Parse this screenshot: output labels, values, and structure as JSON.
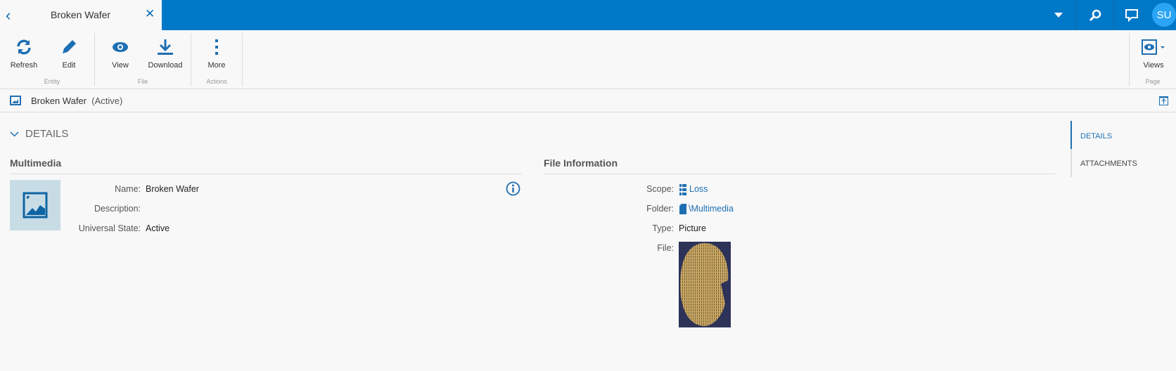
{
  "tab": {
    "title": "Broken Wafer"
  },
  "topbar": {
    "avatar": "SU",
    "icons": [
      "dropdown-caret-icon",
      "search-icon",
      "chat-icon"
    ]
  },
  "toolbar": {
    "buttons": [
      {
        "label": "Refresh"
      },
      {
        "label": "Edit"
      },
      {
        "label": "View"
      },
      {
        "label": "Download"
      },
      {
        "label": "More"
      },
      {
        "label": "Views"
      }
    ],
    "groups": [
      "Entity",
      "File",
      "Actions",
      "Page"
    ]
  },
  "header": {
    "title": "Broken Wafer",
    "status": "(Active)"
  },
  "details": {
    "section_label": "DETAILS",
    "multimedia": {
      "heading": "Multimedia",
      "fields": [
        {
          "label": "Name:",
          "value": "Broken Wafer"
        },
        {
          "label": "Description:",
          "value": ""
        },
        {
          "label": "Universal State:",
          "value": "Active"
        }
      ]
    },
    "file_info": {
      "heading": "File Information",
      "fields": [
        {
          "label": "Scope:",
          "value": "Loss"
        },
        {
          "label": "Folder:",
          "value": "\\Multimedia"
        },
        {
          "label": "Type:",
          "value": "Picture"
        },
        {
          "label": "File:",
          "value": ""
        }
      ]
    }
  },
  "side_nav": {
    "items": [
      {
        "label": "DETAILS",
        "active": true
      },
      {
        "label": "ATTACHMENTS",
        "active": false
      }
    ]
  },
  "colors": {
    "brand": "#0078c8",
    "accent": "#1e6fb2"
  }
}
